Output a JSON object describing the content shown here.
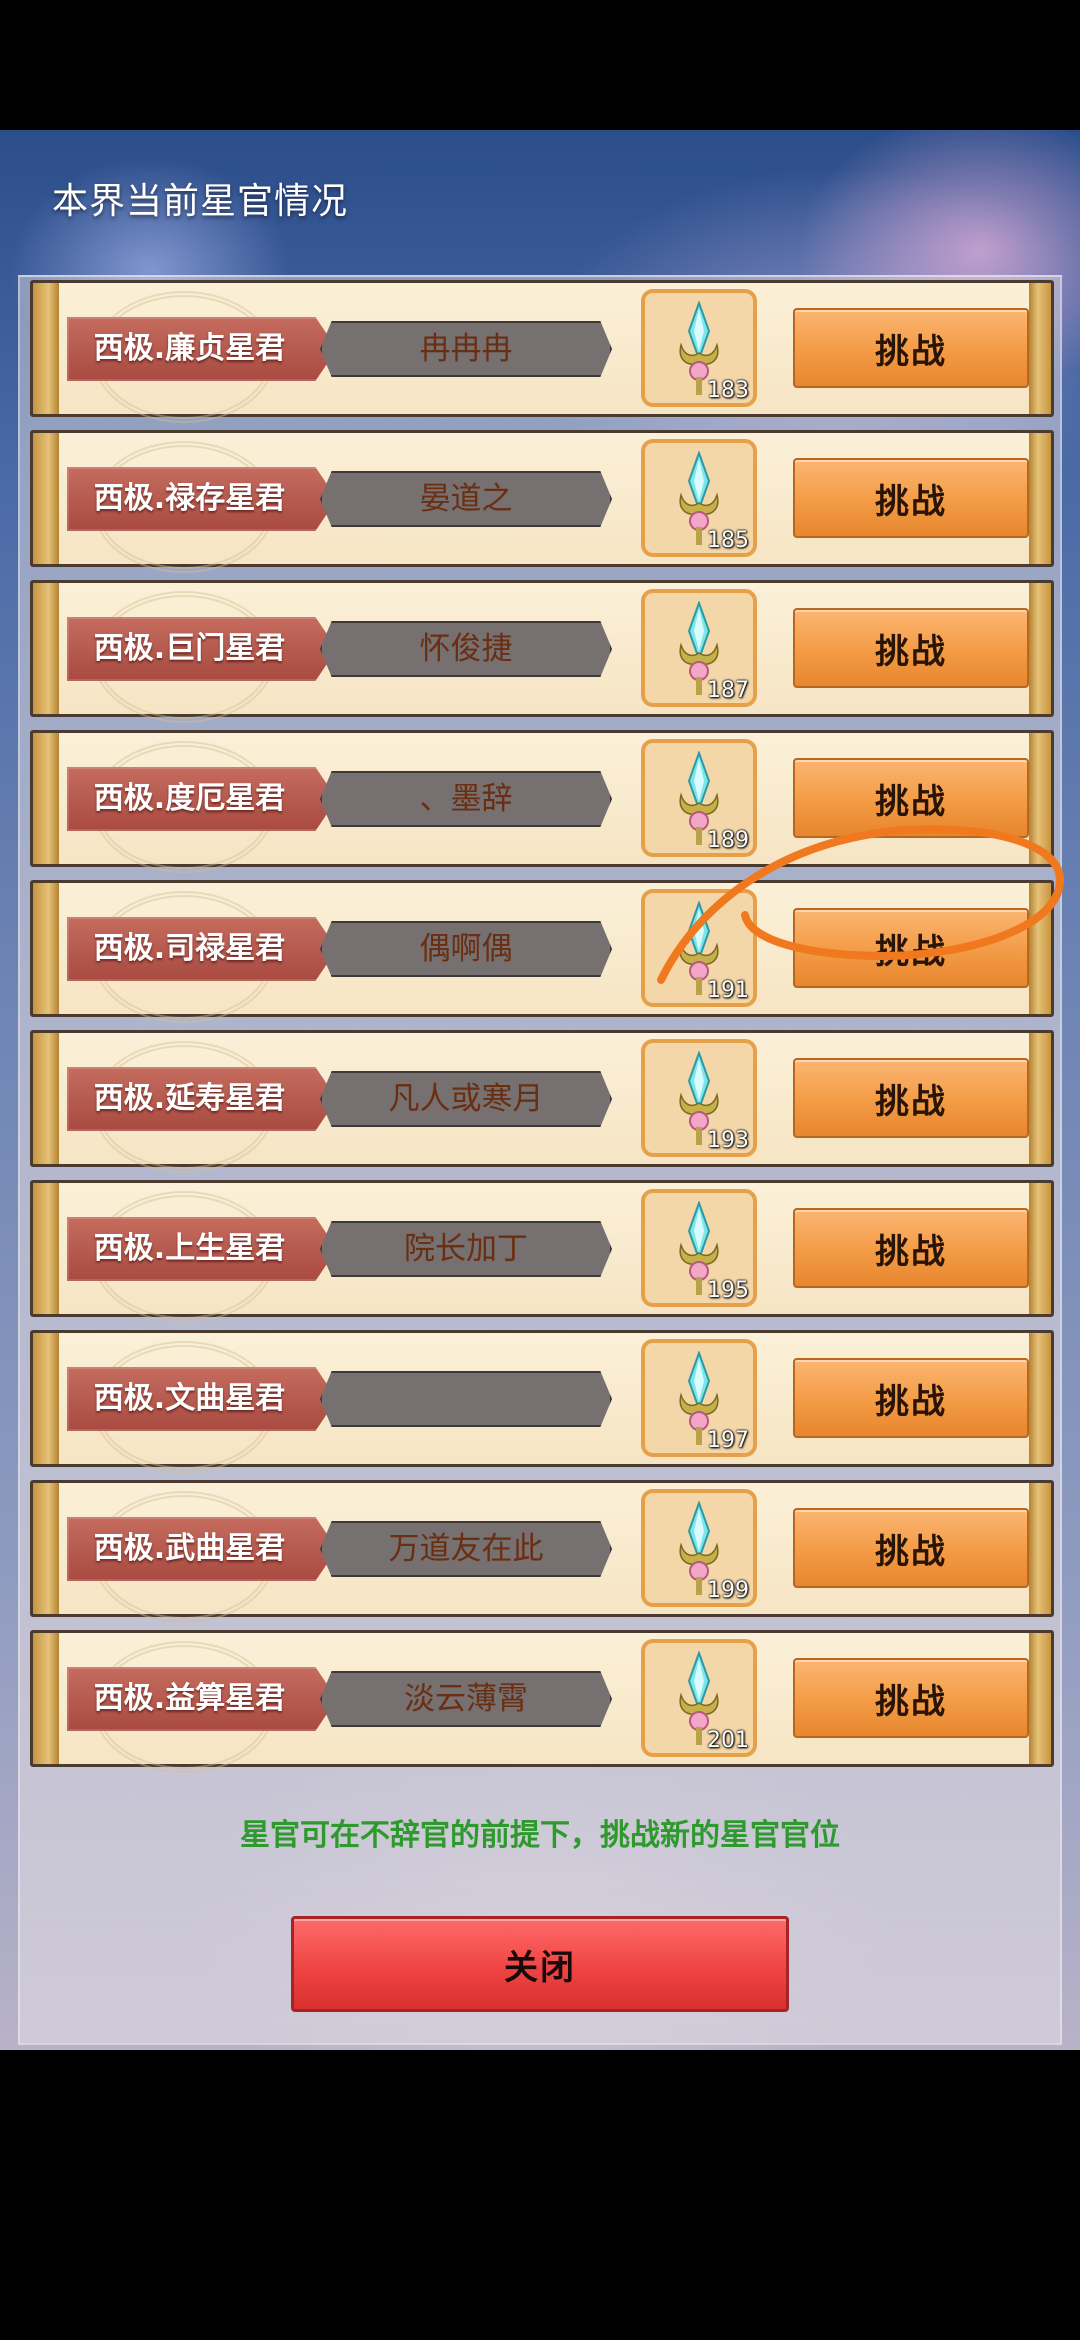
{
  "header": {
    "title": "本界当前星官情况"
  },
  "colors": {
    "annotation": "#f0781e",
    "hint": "#2e9a2e",
    "challenge": "#f39b45",
    "close": "#f04444"
  },
  "rows": [
    {
      "rank": "西极.廉贞星君",
      "name": "冉冉冉",
      "item_count": "183",
      "action": "挑战"
    },
    {
      "rank": "西极.禄存星君",
      "name": "晏道之",
      "item_count": "185",
      "action": "挑战"
    },
    {
      "rank": "西极.巨门星君",
      "name": "怀俊捷",
      "item_count": "187",
      "action": "挑战"
    },
    {
      "rank": "西极.度厄星君",
      "name": "、墨辞",
      "item_count": "189",
      "action": "挑战"
    },
    {
      "rank": "西极.司禄星君",
      "name": "偶啊偶",
      "item_count": "191",
      "action": "挑战"
    },
    {
      "rank": "西极.延寿星君",
      "name": "凡人或寒月",
      "item_count": "193",
      "action": "挑战"
    },
    {
      "rank": "西极.上生星君",
      "name": "院长加丁",
      "item_count": "195",
      "action": "挑战"
    },
    {
      "rank": "西极.文曲星君",
      "name": "",
      "item_count": "197",
      "action": "挑战"
    },
    {
      "rank": "西极.武曲星君",
      "name": "万道友在此",
      "item_count": "199",
      "action": "挑战"
    },
    {
      "rank": "西极.益算星君",
      "name": "淡云薄霄",
      "item_count": "201",
      "action": "挑战"
    }
  ],
  "footer": {
    "hint": "星官可在不辞官的前提下，挑战新的星官官位",
    "close_label": "关闭"
  }
}
